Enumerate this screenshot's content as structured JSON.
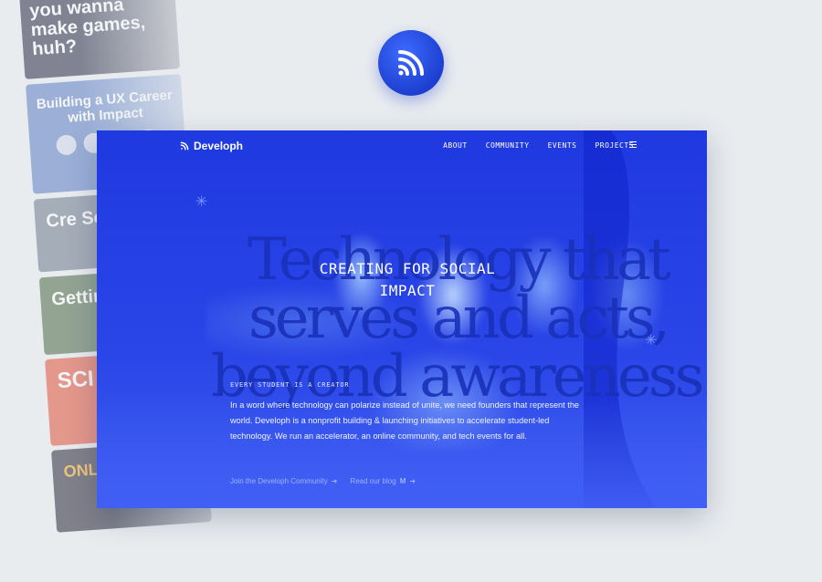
{
  "collage": {
    "poster1_title": "you wanna make games, huh?",
    "poster2_title": "Building a UX Career with Impact",
    "poster3_title": "Cre Se",
    "poster4_title": "Gettin Int",
    "poster5_title": "SCI NIG",
    "poster6_title": "ONLINE"
  },
  "site": {
    "logo_text": "Developh",
    "nav": [
      "ABOUT",
      "COMMUNITY",
      "EVENTS",
      "PROJECTS"
    ],
    "big_serif_lines": [
      "Technology that",
      "serves and acts,",
      "beyond awareness."
    ],
    "headline_lines": [
      "CREATING FOR SOCIAL",
      "IMPACT"
    ],
    "eyebrow": "EVERY STUDENT IS A CREATOR",
    "body": "In a word where technology can polarize instead of unite, we need founders that represent the world. Developh is a nonprofit building & launching initiatives to accelerate student-led technology. We run an accelerator, an online community, and tech events for all.",
    "cta_community": "Join the Developh Community",
    "cta_blog": "Read our blog",
    "menu_icon": "hamburger-icon",
    "logo_icon": "rss-icon"
  },
  "colors": {
    "page_bg": "#e9ecef",
    "site_blue": "#2a46e8",
    "accent": "#1d3fcf"
  }
}
